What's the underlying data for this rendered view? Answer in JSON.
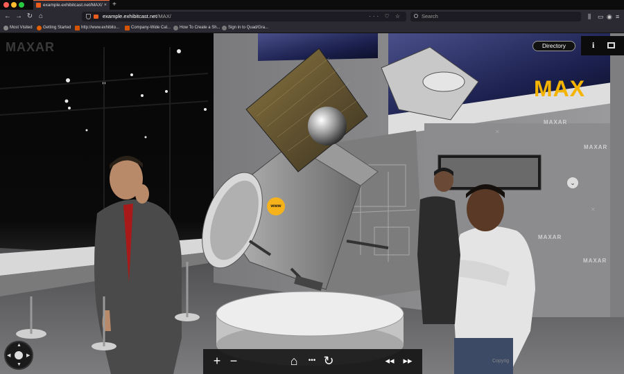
{
  "browser": {
    "tab_title": "example.exhibitcast.net/MAX/",
    "tab_close": "×",
    "new_tab": "+",
    "url_host": "example.exhibitcast.net",
    "url_path": "/MAX/",
    "url_icons": "··· ♡ ☆",
    "search_placeholder": "Search",
    "bookmarks": [
      "Most Visited",
      "Getting Started",
      "http://www.exhibito...",
      "Company-Wide Cal...",
      "How To Create a Sh...",
      "Sign in to Quad/Gra..."
    ]
  },
  "scene": {
    "logo": "MAXAR",
    "directory_label": "Directory",
    "info_label": "i",
    "badge_label": "www",
    "booth_big_logo": "MAX",
    "wall_signs": [
      "MAXAR",
      "MAXAR",
      "MAXAR",
      "MAXAR"
    ],
    "copyright": "Copyrig"
  },
  "controls": {
    "zoom_in": "+",
    "zoom_out": "−",
    "home": "⌂",
    "more": "•••",
    "refresh": "↻",
    "prev": "◂◂",
    "next": "▸▸"
  },
  "colors": {
    "accent_gold": "#f4b400",
    "tab_accent": "#ff7139"
  }
}
